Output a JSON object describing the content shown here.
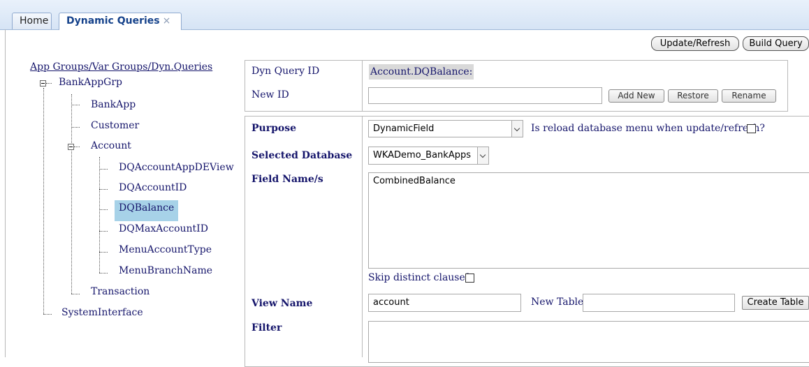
{
  "tabs": [
    {
      "label": "Home"
    },
    {
      "label": "Dynamic Queries",
      "close": "×"
    }
  ],
  "toolbar": {
    "update_label": "Update/Refresh",
    "build_label": "Build Query"
  },
  "tree": {
    "root_label": "App Groups/Var Groups/Dyn.Queries",
    "group": "BankAppGrp",
    "children": [
      "BankApp",
      "Customer",
      "Account",
      "Transaction"
    ],
    "account_children": [
      "DQAccountAppDEView",
      "DQAccountID",
      "DQBalance",
      "DQMaxAccountID",
      "MenuAccountType",
      "MenuBranchName"
    ],
    "selected": "DQBalance",
    "other_root": "SystemInterface"
  },
  "form": {
    "dyn_query_id_label": "Dyn Query ID",
    "dyn_query_id_value": "Account.DQBalance:",
    "new_id_label": "New ID",
    "new_id_value": "",
    "add_new_label": "Add New",
    "restore_label": "Restore",
    "rename_label": "Rename",
    "purpose_label": "Purpose",
    "purpose_value": "DynamicField",
    "reload_label": "Is reload database menu when update/refresh?",
    "selected_db_label": "Selected Database",
    "selected_db_value": "WKADemo_BankApps",
    "field_names_label": "Field Name/s",
    "field_names_value": "CombinedBalance",
    "skip_distinct_label": "Skip distinct clause?",
    "view_name_label": "View Name",
    "view_name_value": "account",
    "new_table_label": "New Table:",
    "new_table_value": "",
    "create_table_label": "Create Table",
    "filter_label": "Filter",
    "filter_value": ""
  }
}
